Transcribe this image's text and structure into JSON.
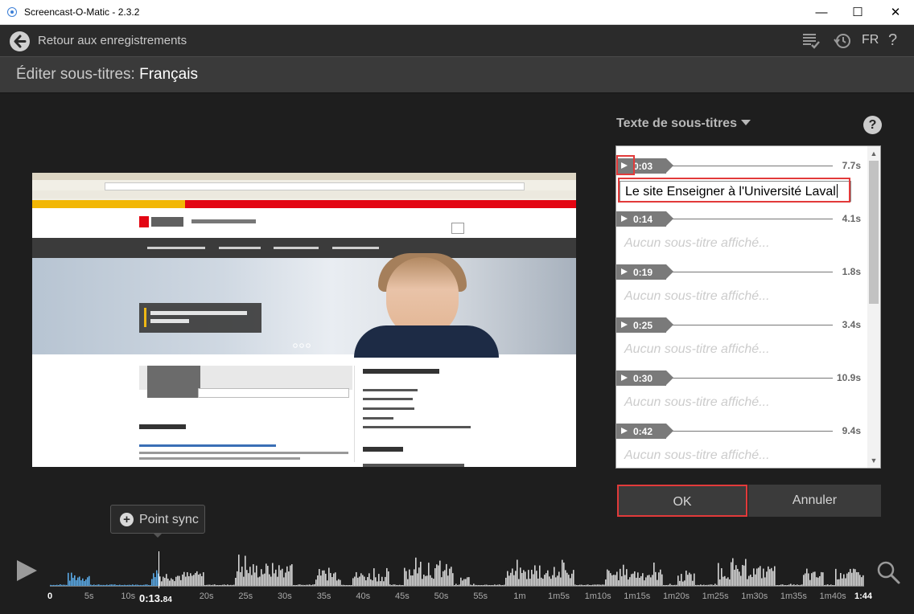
{
  "window": {
    "title": "Screencast-O-Matic - 2.3.2",
    "minimize": "—",
    "maximize": "☐",
    "close": "✕"
  },
  "toolbar": {
    "back_label": "Retour aux enregistrements",
    "lang": "FR",
    "help": "?",
    "icons": [
      "checklist-icon",
      "history-icon"
    ]
  },
  "header": {
    "label": "Éditer sous-titres:",
    "language": "Français"
  },
  "panel": {
    "title": "Texte de sous-titres",
    "help": "?"
  },
  "subtitles": [
    {
      "time": "0:03",
      "duration": "7.7s",
      "text": "Le site Enseigner à l'Université Laval",
      "editing": true
    },
    {
      "time": "0:14",
      "duration": "4.1s",
      "text": "Aucun sous-titre affiché..."
    },
    {
      "time": "0:19",
      "duration": "1.8s",
      "text": "Aucun sous-titre affiché..."
    },
    {
      "time": "0:25",
      "duration": "3.4s",
      "text": "Aucun sous-titre affiché..."
    },
    {
      "time": "0:30",
      "duration": "10.9s",
      "text": "Aucun sous-titre affiché..."
    },
    {
      "time": "0:42",
      "duration": "9.4s",
      "text": "Aucun sous-titre affiché..."
    }
  ],
  "buttons": {
    "ok": "OK",
    "cancel": "Annuler"
  },
  "sync": {
    "label": "Point sync"
  },
  "timeline": {
    "current_main": "0:13.",
    "current_frac": "84",
    "end": "1:44",
    "ticks": [
      "0",
      "5s",
      "10s",
      "20s",
      "25s",
      "30s",
      "35s",
      "40s",
      "45s",
      "50s",
      "55s",
      "1m",
      "1m5s",
      "1m10s",
      "1m15s",
      "1m20s",
      "1m25s",
      "1m30s",
      "1m35s",
      "1m40s"
    ],
    "tick_seconds": [
      0,
      5,
      10,
      20,
      25,
      30,
      35,
      40,
      45,
      50,
      55,
      60,
      65,
      70,
      75,
      80,
      85,
      90,
      95,
      100
    ],
    "total_seconds": 104,
    "current_seconds": 13.84,
    "colors": {
      "played": "#5aa9e6",
      "unplayed": "#d6d6d6"
    }
  }
}
